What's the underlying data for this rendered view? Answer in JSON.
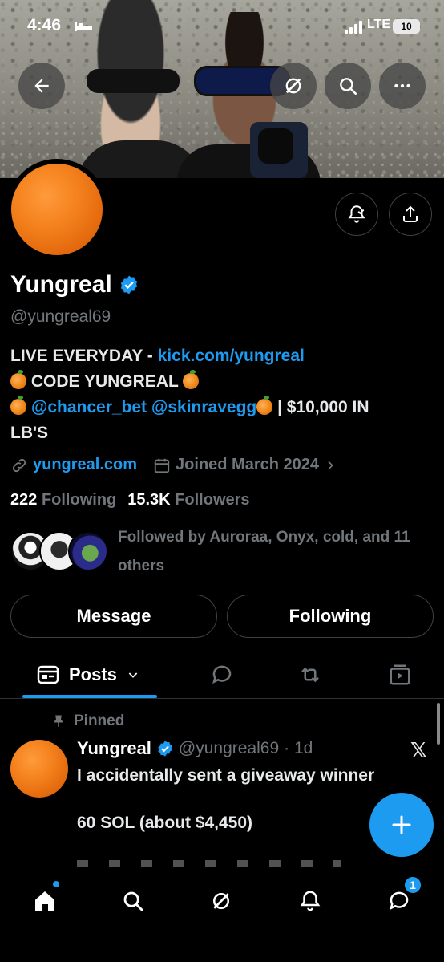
{
  "status_bar": {
    "time": "4:46",
    "network": "LTE",
    "battery": "10"
  },
  "profile": {
    "name": "Yungreal",
    "handle": "@yungreal69",
    "bio": {
      "line1_text": "LIVE EVERYDAY - ",
      "line1_link": "kick.com/yungreal",
      "line2_text": "CODE YUNGREAL",
      "line3_link1": "@chancer_bet",
      "line3_link2": "@skinravegg",
      "line3_text": " | $10,000 IN",
      "line4_text": "LB'S"
    },
    "website": "yungreal.com",
    "joined": "Joined March 2024",
    "following_count": "222",
    "following_label": "Following",
    "followers_count": "15.3K",
    "followers_label": "Followers",
    "followed_by": "Followed by Auroraa, Onyx, cold, and 11 others"
  },
  "actions": {
    "message_label": "Message",
    "following_label": "Following"
  },
  "tabs": {
    "posts_label": "Posts"
  },
  "post": {
    "pinned_label": "Pinned",
    "author_name": "Yungreal",
    "author_handle": "@yungreal69",
    "time": "· 1d",
    "text_line1": "I accidentally sent a giveaway winner",
    "text_line2": "60 SOL (about $4,450)"
  },
  "bottom_nav": {
    "messages_badge": "1"
  },
  "colors": {
    "accent": "#1d9bf0",
    "background": "#000000",
    "muted": "#71767b"
  }
}
